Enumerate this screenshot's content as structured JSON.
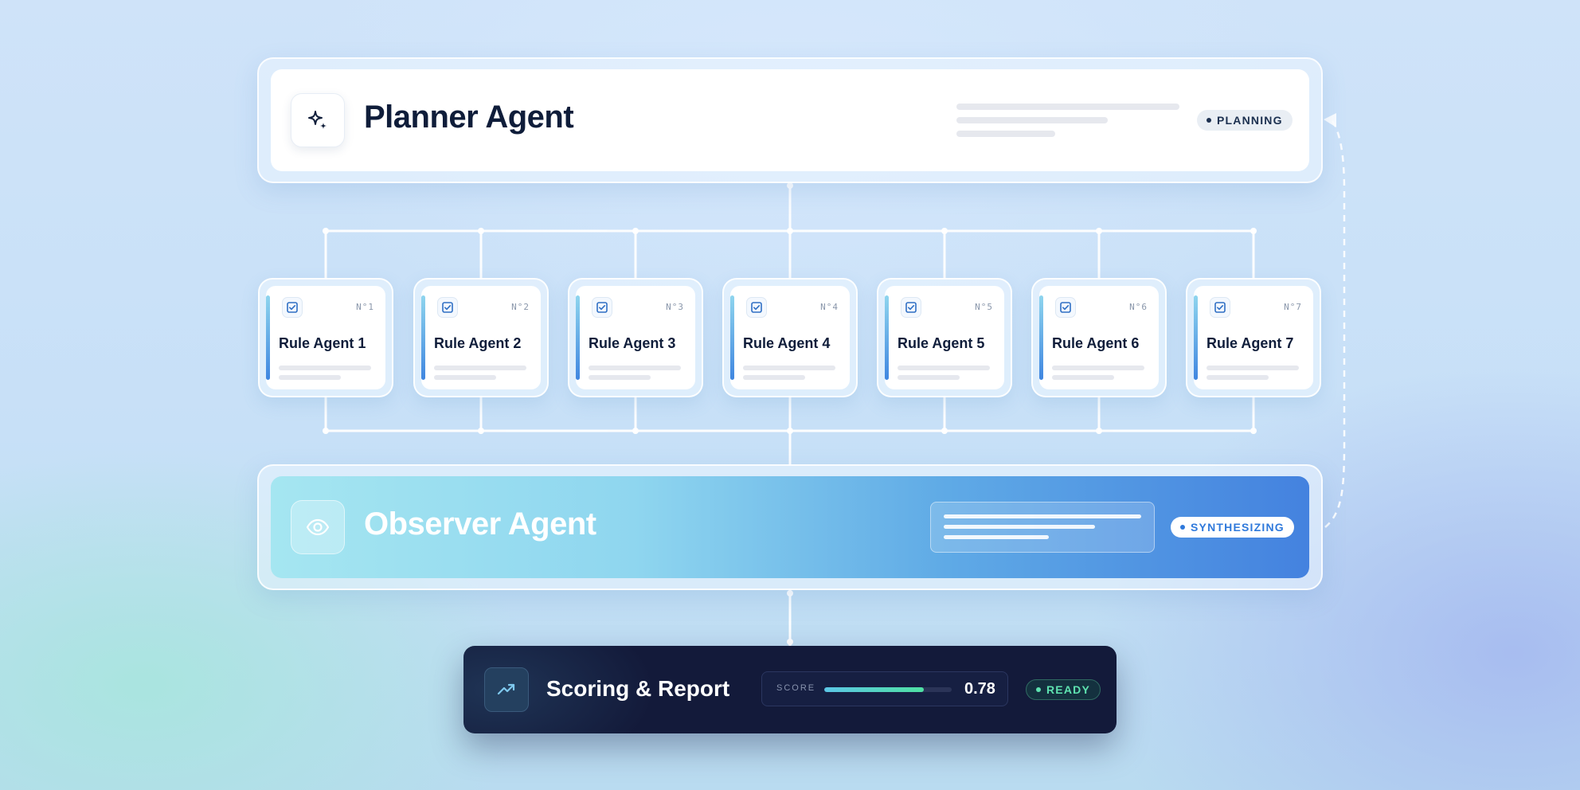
{
  "planner": {
    "title": "Planner Agent",
    "status": "PLANNING",
    "icon": "sparkles-icon"
  },
  "rule_agents": [
    {
      "title": "Rule Agent 1",
      "number": "N°1",
      "icon": "checkbox-icon"
    },
    {
      "title": "Rule Agent 2",
      "number": "N°2",
      "icon": "checkbox-icon"
    },
    {
      "title": "Rule Agent 3",
      "number": "N°3",
      "icon": "checkbox-icon"
    },
    {
      "title": "Rule Agent 4",
      "number": "N°4",
      "icon": "checkbox-icon"
    },
    {
      "title": "Rule Agent 5",
      "number": "N°5",
      "icon": "checkbox-icon"
    },
    {
      "title": "Rule Agent 6",
      "number": "N°6",
      "icon": "checkbox-icon"
    },
    {
      "title": "Rule Agent 7",
      "number": "N°7",
      "icon": "checkbox-icon"
    }
  ],
  "observer": {
    "title": "Observer Agent",
    "status": "SYNTHESIZING",
    "icon": "eye-icon"
  },
  "scoring": {
    "title": "Scoring & Report",
    "score_label": "SCORE",
    "score_value": "0.78",
    "score_fraction": 0.78,
    "status": "READY",
    "icon": "trending-up-icon"
  },
  "colors": {
    "planner_text": "#0f1d3a",
    "observer_gradient_start": "#a5e6f1",
    "observer_gradient_end": "#4482df",
    "scoring_background": "#131a3a",
    "ready_accent": "#5ee3b0",
    "rule_accent": "#3f86e0"
  }
}
